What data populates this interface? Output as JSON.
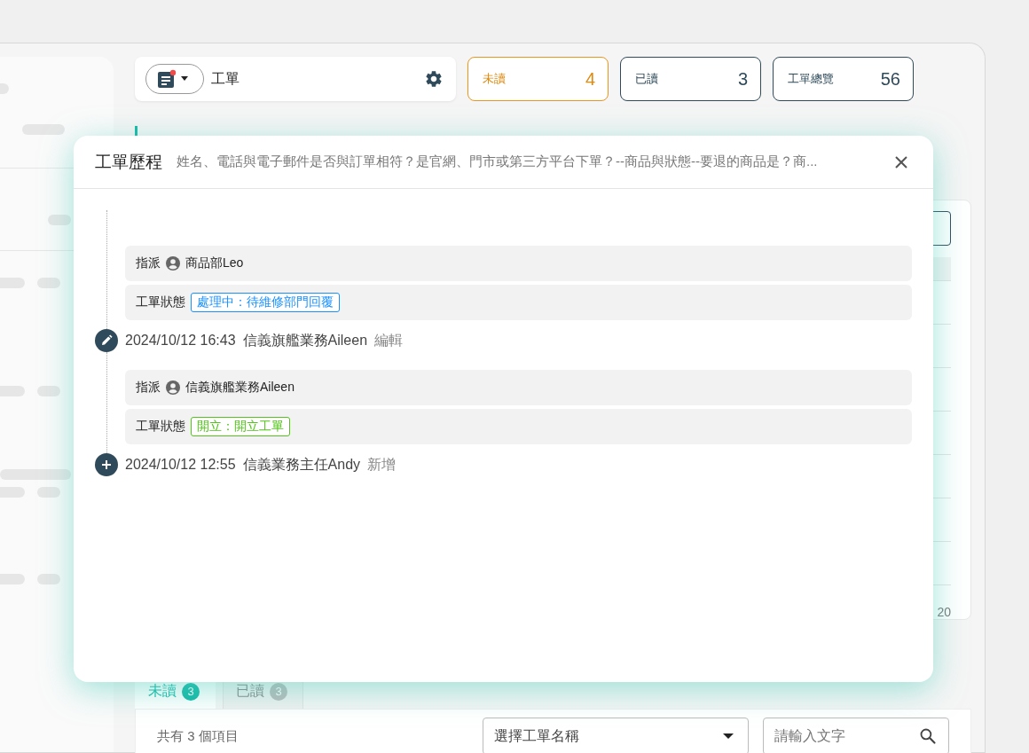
{
  "toolbar": {
    "unread_dot": true,
    "title": "工單"
  },
  "stats": [
    {
      "label": "未讀",
      "count": "4",
      "selected": true
    },
    {
      "label": "已讀",
      "count": "3",
      "selected": false
    },
    {
      "label": "工單總覽",
      "count": "56",
      "selected": false
    }
  ],
  "table": {
    "pagination": "20"
  },
  "tabs": [
    {
      "label": "未讀",
      "count": "3",
      "selected": true
    },
    {
      "label": "已讀",
      "count": "3",
      "selected": false
    }
  ],
  "list_toolbar": {
    "summary": "共有 3 個項目",
    "select": {
      "placeholder": "選擇工單名稱"
    },
    "search": {
      "placeholder": "請輸入文字"
    }
  },
  "modal": {
    "title": "工單歷程",
    "subtitle": "姓名、電話與電子郵件是否與訂單相符？是官網、門市或第三方平台下單？--商品與狀態--要退的商品是？商...",
    "events": [
      {
        "kind": "edit",
        "rows": [
          {
            "kind": "assign",
            "label": "指派",
            "value": "商品部Leo"
          },
          {
            "kind": "status",
            "label": "工單狀態",
            "value": "處理中：待維修部門回覆",
            "color": "#1890ff"
          }
        ],
        "time": "2024/10/12 16:43",
        "user": "信義旗艦業務Aileen",
        "action": "編輯"
      },
      {
        "kind": "create",
        "rows": [
          {
            "kind": "assign",
            "label": "指派",
            "value": "信義旗艦業務Aileen"
          },
          {
            "kind": "status",
            "label": "工單狀態",
            "value": "開立：開立工單",
            "color": "#52c41a"
          }
        ],
        "time": "2024/10/12 12:55",
        "user": "信義業務主任Andy",
        "action": "新增"
      }
    ]
  }
}
